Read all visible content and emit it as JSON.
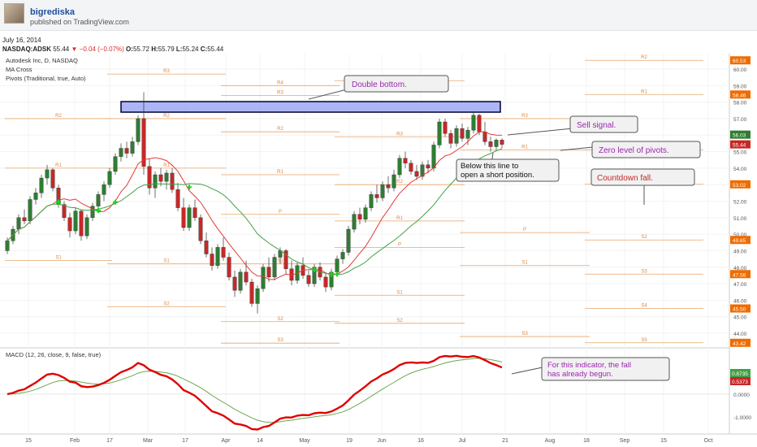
{
  "header": {
    "username": "bigrediska",
    "published": "published on TradingView.com"
  },
  "date": "July 16, 2014",
  "quote": {
    "symbol": "NASDAQ:ADSK",
    "last": "55.44",
    "change": "−0.04 (−0.07%)",
    "open_label": "O:",
    "open": "55.72",
    "high_label": "H:",
    "high": "55.79",
    "low_label": "L:",
    "low": "55.24",
    "close_label": "C:",
    "close": "55.44"
  },
  "legend": {
    "title": "Autodesk Inc, D, NASDAQ",
    "ma": "MA Cross",
    "pivots": "Pivots (Traditional, true, Auto)",
    "macd": "MACD (12, 26, close, 9, false, true)"
  },
  "annotations": {
    "double_bottom": "Double bottom.",
    "sell_signal": "Sell signal.",
    "zero_level": "Zero level of pivots.",
    "below_line_1": "Below this line to",
    "below_line_2": "open a short position.",
    "countdown": "Countdown fall.",
    "macd_note_1": "For this indicator, the fall",
    "macd_note_2": "has already begun."
  },
  "colors": {
    "candle_up": "#2e7d32",
    "candle_down": "#c62828",
    "ma_fast": "#e53935",
    "ma_slow": "#43a047",
    "pivot_line": "#e8a56b",
    "macd_line": "#e00000",
    "signal_line": "#6aa84f",
    "zone_fill": "#9fa8f5",
    "annotation_purple": "#9c27b0",
    "annotation_red": "#c62828"
  },
  "chart_data": {
    "type": "candlestick",
    "price_axis": {
      "ticks": [
        "61.00",
        "60.00",
        "59.00",
        "58.00",
        "57.00",
        "56.00",
        "55.00",
        "54.00",
        "53.00",
        "52.00",
        "51.00",
        "50.00",
        "49.00",
        "48.00",
        "47.00",
        "46.00",
        "45.00",
        "44.00"
      ],
      "ylim": [
        43,
        61.5
      ],
      "badges": [
        {
          "value": 60.53,
          "label": "60.53",
          "color": "#ef6c00"
        },
        {
          "value": 58.46,
          "label": "58.46",
          "color": "#ef6c00"
        },
        {
          "value": 56.03,
          "label": "56.03",
          "color": "#2e7d32"
        },
        {
          "value": 55.44,
          "label": "55.44",
          "color": "#c62828"
        },
        {
          "value": 53.02,
          "label": "53.02",
          "color": "#ef6c00"
        },
        {
          "value": 49.65,
          "label": "49.65",
          "color": "#ef6c00"
        },
        {
          "value": 47.58,
          "label": "47.58",
          "color": "#ef6c00"
        },
        {
          "value": 45.5,
          "label": "45.50",
          "color": "#ef6c00"
        },
        {
          "value": 43.42,
          "label": "43.42",
          "color": "#ef6c00"
        }
      ]
    },
    "macd_axis": {
      "ticks": [
        "1.0000",
        "0.0000",
        "-1.0000"
      ],
      "badges": [
        {
          "label": "0.8735",
          "color": "#43a047"
        },
        {
          "label": "0.5373",
          "color": "#c62828"
        }
      ]
    },
    "time_axis": [
      "15",
      "Feb",
      "17",
      "Mar",
      "17",
      "Apr",
      "14",
      "May",
      "19",
      "Jun",
      "16",
      "Jul",
      "21",
      "Aug",
      "18",
      "Sep",
      "15",
      "Oct"
    ],
    "pivot_periods": [
      {
        "start": 0,
        "end": 18,
        "levels": {
          "R2": 57.0,
          "R1": 54.0,
          "S1": 48.4
        }
      },
      {
        "start": 18,
        "end": 38,
        "levels": {
          "R3": 59.7,
          "R2": 57.0,
          "R1": 54.0,
          "S1": 48.2,
          "S2": 45.6
        }
      },
      {
        "start": 38,
        "end": 58,
        "levels": {
          "R4": 59.0,
          "R3": 58.4,
          "R2": 56.2,
          "R1": 53.6,
          "P": 51.2,
          "S1": 48.2,
          "S2": 44.7,
          "S3": 43.4
        }
      },
      {
        "start": 58,
        "end": 80,
        "levels": {
          "R4": 59.3,
          "R3": 55.9,
          "R2": 53.0,
          "R1": 50.8,
          "P": 49.2,
          "S1": 46.3,
          "S2": 44.6
        }
      },
      {
        "start": 80,
        "end": 102,
        "levels": {
          "R3": 57.0,
          "R1": 55.1,
          "P": 50.1,
          "S1": 48.1,
          "S3": 43.8
        }
      },
      {
        "start": 102,
        "end": 122,
        "levels": {
          "R2": 60.53,
          "R1": 58.46,
          "P": 55.1,
          "S1": 53.02,
          "S2": 49.65,
          "S3": 47.58,
          "S4": 45.5,
          "S5": 43.42
        }
      }
    ],
    "candles": [
      [
        49.0,
        49.8,
        48.8,
        49.6
      ],
      [
        49.6,
        50.5,
        49.4,
        50.3
      ],
      [
        50.3,
        51.2,
        50.0,
        51.0
      ],
      [
        51.0,
        51.5,
        50.6,
        50.8
      ],
      [
        50.8,
        52.3,
        50.6,
        52.1
      ],
      [
        52.1,
        52.8,
        51.8,
        52.5
      ],
      [
        52.5,
        53.6,
        52.2,
        53.4
      ],
      [
        53.4,
        54.2,
        53.0,
        53.9
      ],
      [
        53.9,
        54.0,
        52.6,
        52.8
      ],
      [
        52.8,
        53.0,
        51.6,
        51.8
      ],
      [
        51.8,
        52.0,
        50.8,
        51.0
      ],
      [
        51.0,
        51.3,
        49.8,
        50.2
      ],
      [
        50.2,
        51.6,
        50.0,
        51.4
      ],
      [
        51.4,
        51.5,
        49.6,
        49.9
      ],
      [
        49.9,
        51.2,
        49.7,
        51.0
      ],
      [
        51.0,
        51.9,
        50.8,
        51.7
      ],
      [
        51.7,
        52.6,
        51.4,
        52.4
      ],
      [
        52.4,
        53.2,
        52.0,
        53.0
      ],
      [
        53.0,
        54.0,
        52.8,
        53.8
      ],
      [
        53.8,
        54.9,
        53.6,
        54.7
      ],
      [
        54.7,
        55.5,
        54.4,
        55.2
      ],
      [
        55.2,
        55.6,
        54.6,
        54.9
      ],
      [
        54.9,
        55.9,
        54.7,
        55.6
      ],
      [
        55.6,
        57.2,
        55.4,
        57.0
      ],
      [
        57.0,
        58.6,
        53.6,
        54.1
      ],
      [
        54.1,
        54.6,
        52.4,
        52.8
      ],
      [
        52.8,
        53.8,
        52.2,
        53.6
      ],
      [
        53.6,
        54.0,
        52.9,
        53.2
      ],
      [
        53.2,
        53.9,
        52.7,
        53.7
      ],
      [
        53.7,
        54.0,
        52.5,
        52.7
      ],
      [
        52.7,
        53.1,
        51.4,
        51.6
      ],
      [
        51.6,
        52.2,
        50.2,
        50.4
      ],
      [
        50.4,
        51.8,
        50.2,
        51.6
      ],
      [
        51.6,
        52.1,
        50.8,
        51.0
      ],
      [
        51.0,
        51.2,
        49.4,
        49.6
      ],
      [
        49.6,
        50.1,
        48.6,
        48.8
      ],
      [
        48.8,
        49.2,
        47.8,
        48.1
      ],
      [
        48.1,
        49.4,
        47.9,
        49.2
      ],
      [
        49.2,
        49.8,
        48.4,
        48.6
      ],
      [
        48.6,
        48.9,
        47.2,
        47.4
      ],
      [
        47.4,
        47.8,
        46.2,
        46.6
      ],
      [
        46.6,
        47.9,
        46.4,
        47.7
      ],
      [
        47.7,
        48.4,
        46.9,
        47.1
      ],
      [
        47.1,
        47.3,
        45.6,
        45.8
      ],
      [
        45.8,
        46.9,
        45.2,
        46.7
      ],
      [
        46.7,
        48.2,
        46.5,
        48.0
      ],
      [
        48.0,
        48.6,
        47.1,
        47.4
      ],
      [
        47.4,
        48.8,
        47.2,
        48.6
      ],
      [
        48.6,
        49.2,
        48.2,
        49.0
      ],
      [
        49.0,
        49.1,
        47.6,
        47.9
      ],
      [
        47.9,
        48.4,
        46.9,
        47.2
      ],
      [
        47.2,
        48.3,
        47.0,
        48.1
      ],
      [
        48.1,
        48.6,
        47.3,
        47.5
      ],
      [
        47.5,
        47.8,
        46.8,
        47.0
      ],
      [
        47.0,
        48.2,
        46.8,
        48.0
      ],
      [
        48.0,
        48.3,
        47.2,
        47.4
      ],
      [
        47.4,
        47.6,
        46.5,
        46.8
      ],
      [
        46.8,
        47.9,
        46.6,
        47.7
      ],
      [
        47.7,
        48.7,
        47.5,
        48.5
      ],
      [
        48.5,
        49.1,
        48.2,
        48.9
      ],
      [
        48.9,
        50.5,
        48.7,
        50.3
      ],
      [
        50.3,
        51.4,
        50.1,
        51.2
      ],
      [
        51.2,
        51.6,
        50.6,
        50.9
      ],
      [
        50.9,
        51.8,
        50.7,
        51.6
      ],
      [
        51.6,
        52.6,
        51.4,
        52.4
      ],
      [
        52.4,
        53.0,
        51.9,
        52.2
      ],
      [
        52.2,
        53.2,
        52.0,
        53.0
      ],
      [
        53.0,
        53.5,
        52.5,
        52.8
      ],
      [
        52.8,
        53.9,
        52.6,
        53.6
      ],
      [
        53.6,
        54.8,
        53.4,
        54.6
      ],
      [
        54.6,
        55.0,
        54.0,
        54.3
      ],
      [
        54.3,
        54.5,
        53.6,
        53.8
      ],
      [
        53.8,
        54.2,
        53.3,
        53.5
      ],
      [
        53.5,
        54.4,
        53.3,
        54.2
      ],
      [
        54.2,
        54.5,
        53.7,
        54.0
      ],
      [
        54.0,
        55.6,
        53.8,
        55.4
      ],
      [
        55.4,
        57.0,
        55.2,
        56.8
      ],
      [
        56.8,
        57.0,
        55.9,
        56.1
      ],
      [
        56.1,
        56.3,
        55.2,
        55.5
      ],
      [
        55.5,
        56.6,
        55.3,
        56.4
      ],
      [
        56.4,
        56.7,
        55.6,
        55.8
      ],
      [
        55.8,
        56.5,
        55.4,
        56.3
      ],
      [
        56.3,
        57.4,
        56.1,
        57.2
      ],
      [
        57.2,
        57.3,
        56.0,
        56.2
      ],
      [
        56.2,
        56.8,
        55.4,
        55.6
      ],
      [
        55.6,
        55.9,
        55.0,
        55.3
      ],
      [
        55.3,
        55.8,
        55.1,
        55.7
      ],
      [
        55.7,
        55.8,
        55.2,
        55.44
      ]
    ]
  }
}
